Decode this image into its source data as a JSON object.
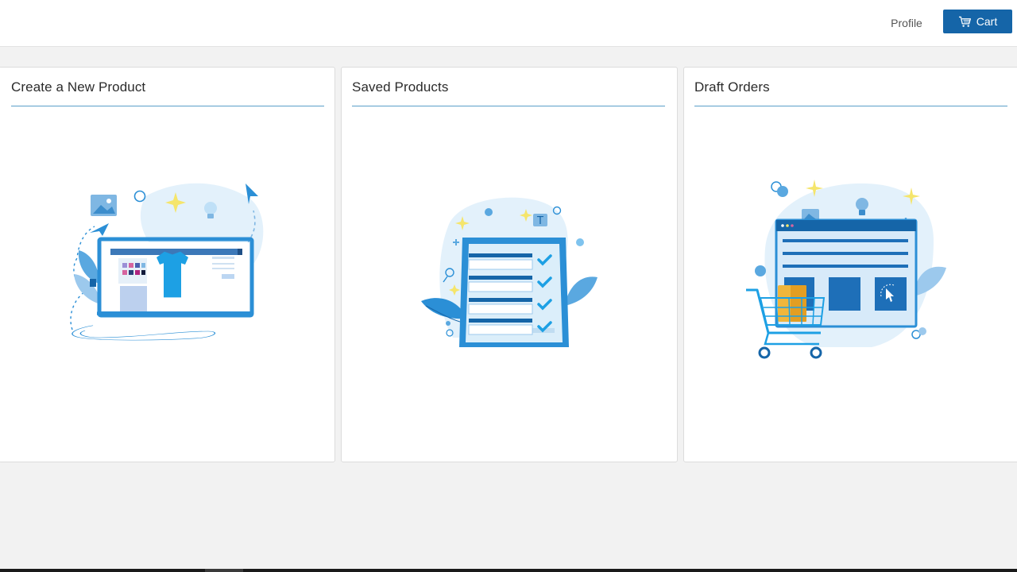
{
  "header": {
    "profile_label": "Profile",
    "cart_label": "Cart",
    "cart_icon": "shopping-cart-icon"
  },
  "cards": [
    {
      "title": "Create a New Product",
      "illustration": "monitor-tshirt-design-illustration"
    },
    {
      "title": "Saved Products",
      "illustration": "checklist-clipboard-illustration"
    },
    {
      "title": "Draft Orders",
      "illustration": "shopping-cart-webpage-illustration"
    }
  ],
  "colors": {
    "accent": "#1565a8",
    "divider": "#5a9fc9",
    "page_bg": "#f2f2f2",
    "illustration_blue": "#2b8fd6",
    "illustration_light": "#e3f1fb",
    "sparkle": "#f5e56b"
  }
}
